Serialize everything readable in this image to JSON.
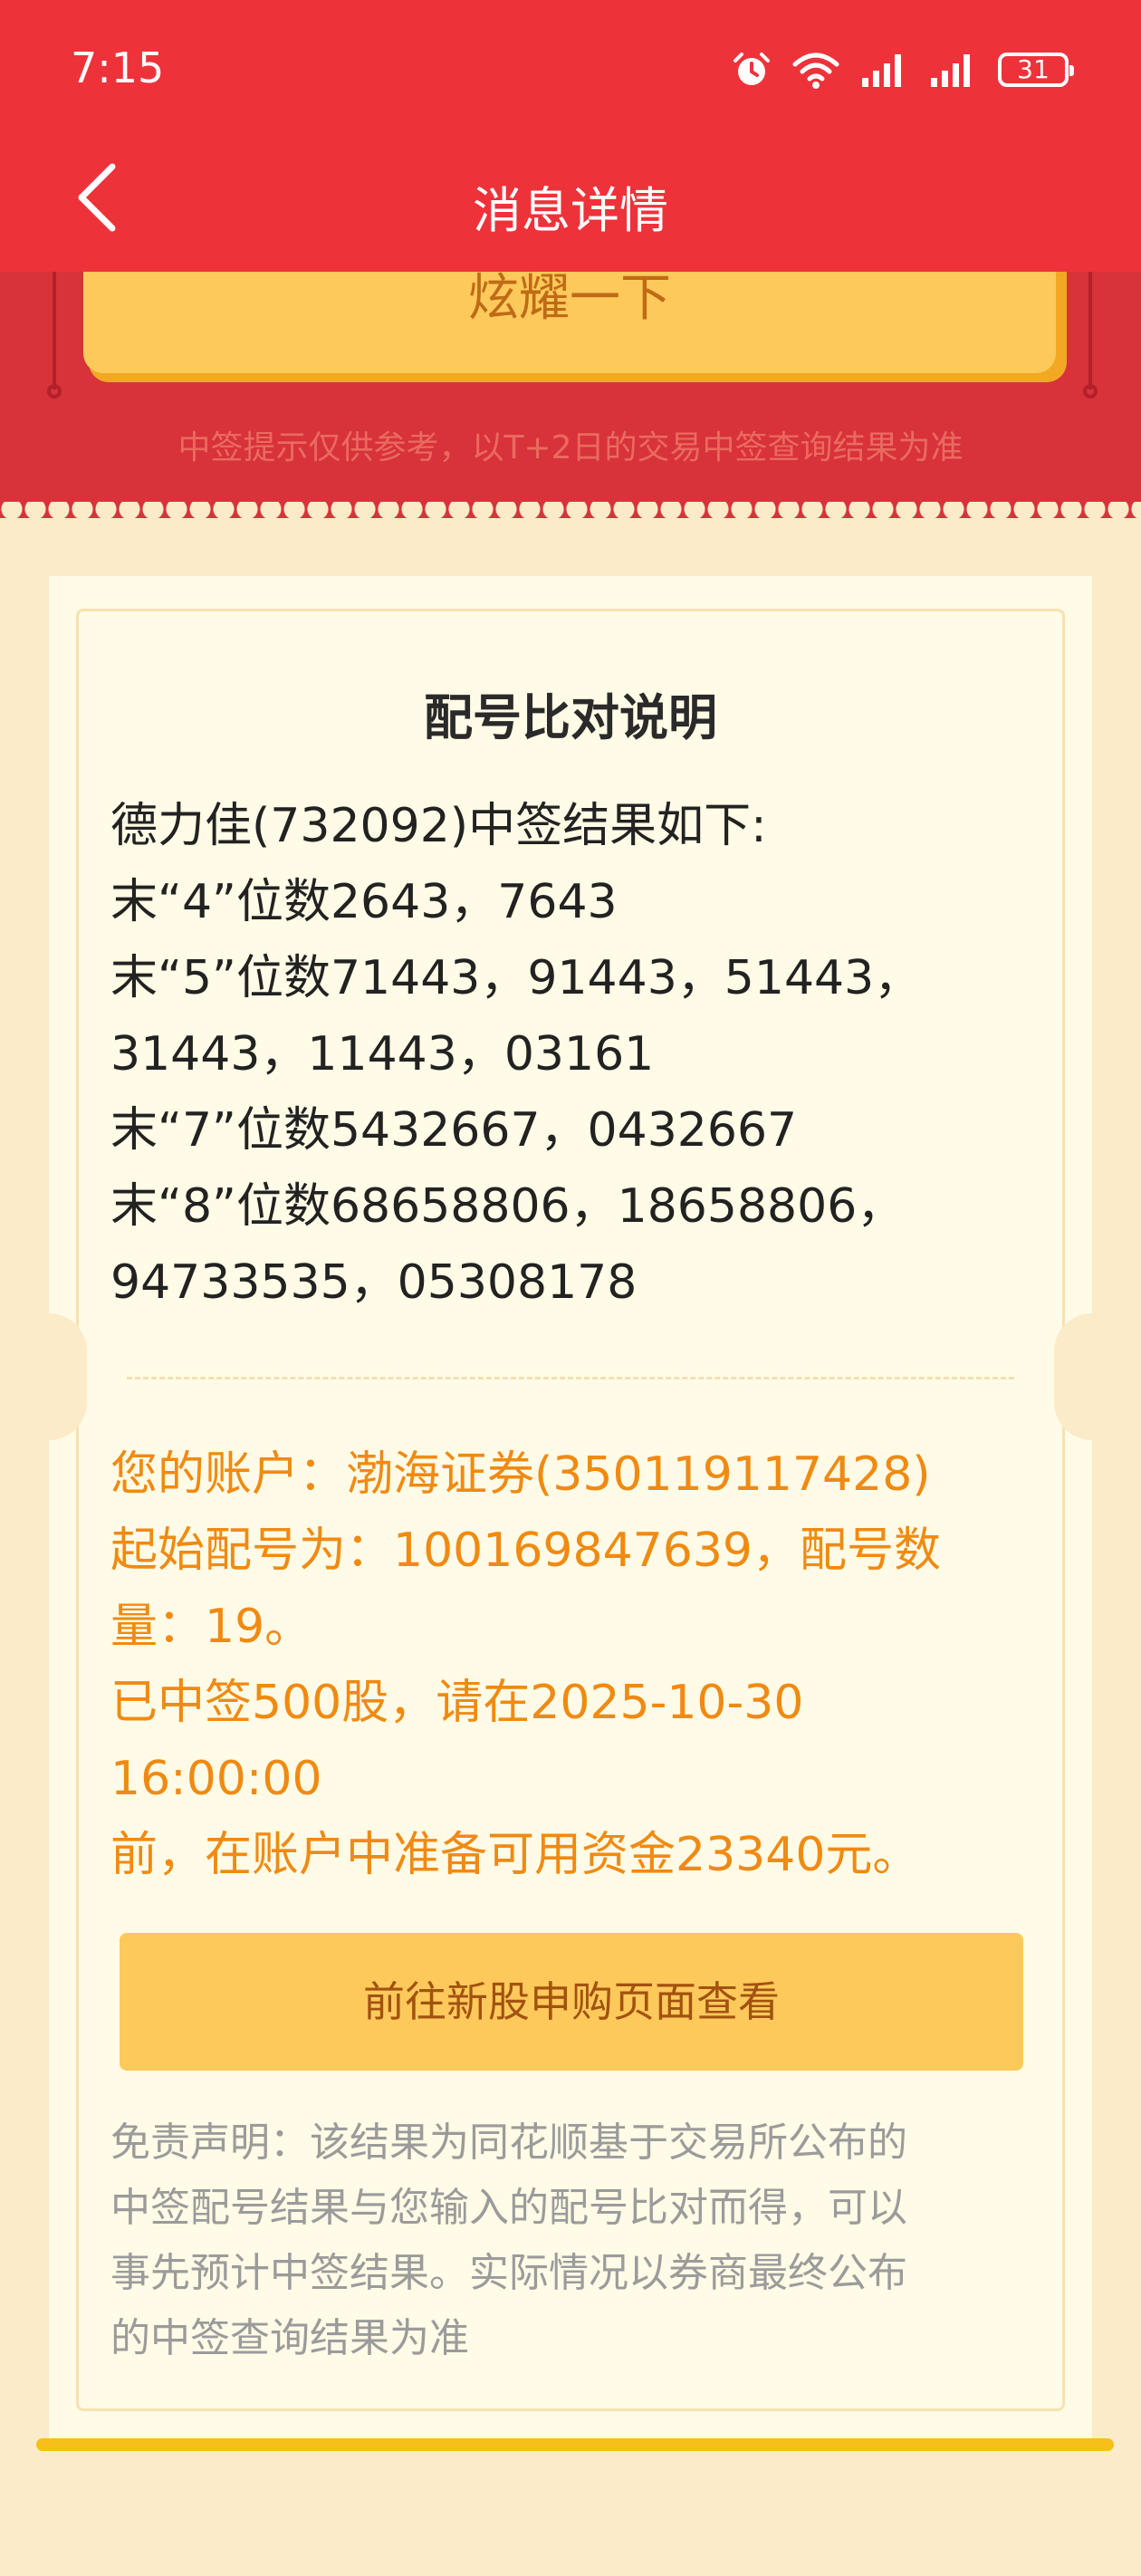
{
  "status": {
    "time": "7:15",
    "battery": "31"
  },
  "header": {
    "title": "消息详情"
  },
  "banner": {
    "button_label": "炫耀一下",
    "note": "中签提示仅供参考，以T+2日的交易中签查询结果为准"
  },
  "card": {
    "title": "配号比对说明",
    "result_lines": [
      "德力佳(732092)中签结果如下:",
      "末“4”位数2643，7643",
      "末“5”位数71443，91443，51443，",
      "31443，11443，03161",
      "末“7”位数5432667，0432667",
      "末“8”位数68658806，18658806，",
      "94733535，05308178"
    ],
    "account_lines": [
      "您的账户：渤海证券(350119117428)",
      "起始配号为：100169847639，配号数",
      "量：19。",
      "已中签500股，请在2025-10-30",
      "16:00:00",
      "前，在账户中准备可用资金23340元。"
    ],
    "cta_label": "前往新股申购页面查看",
    "disclaimer_lines": [
      "免责声明：该结果为同花顺基于交易所公布的",
      "中签配号结果与您输入的配号比对而得，可以",
      "事先预计中签结果。实际情况以券商最终公布",
      "的中签查询结果为准"
    ]
  },
  "colors": {
    "header_red": "#ee323a",
    "accent_orange": "#f08a12",
    "button_yellow": "#fdc95b"
  }
}
